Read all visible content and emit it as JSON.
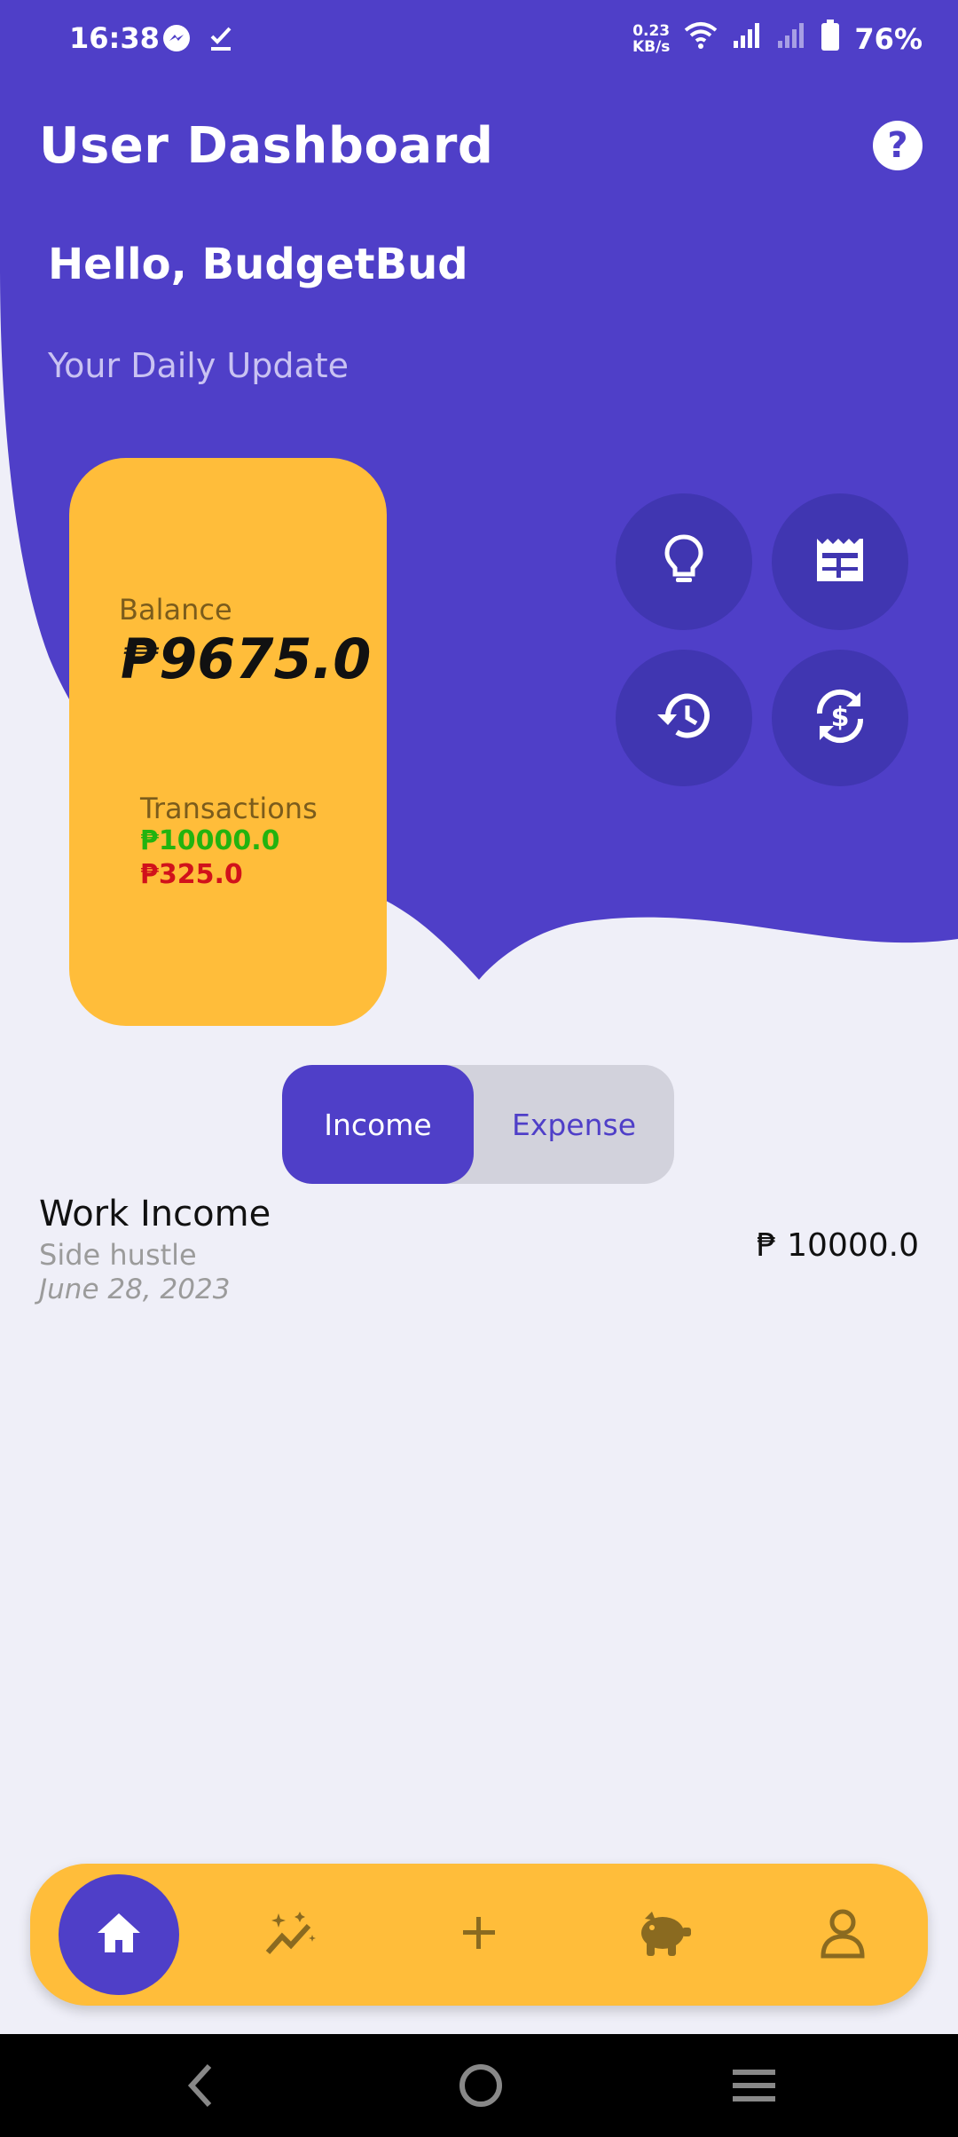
{
  "status_bar": {
    "time": "16:38",
    "net_speed_value": "0.23",
    "net_speed_unit": "KB/s",
    "battery": "76%",
    "icons": [
      "messenger-icon",
      "check-download-icon",
      "wifi-icon",
      "signal-icon",
      "signal-weak-icon",
      "battery-icon"
    ]
  },
  "header": {
    "title": "User Dashboard",
    "help_icon": "?"
  },
  "greeting": "Hello, BudgetBud",
  "subtitle": "Your Daily Update",
  "balance_card": {
    "balance_label": "Balance",
    "balance_value": "₱9675.0",
    "transactions_label": "Transactions",
    "income_total": "₱10000.0",
    "expense_total": "₱325.0"
  },
  "quick_actions": [
    "lightbulb-icon",
    "receipt-icon",
    "history-icon",
    "currency-exchange-icon"
  ],
  "toggle": {
    "income_label": "Income",
    "expense_label": "Expense",
    "selected": "Income"
  },
  "transactions": [
    {
      "title": "Work Income",
      "description": "Side hustle",
      "date": "June 28, 2023",
      "amount": "₱ 10000.0"
    }
  ],
  "bottom_nav": {
    "items": [
      "home-icon",
      "insights-icon",
      "add-icon",
      "savings-icon",
      "profile-icon"
    ],
    "active": "home-icon"
  },
  "colors": {
    "primary": "#4f3fc8",
    "primary_dark": "#4036b1",
    "accent": "#ffbd3a",
    "background": "#efeff8",
    "income": "#22b30f",
    "expense": "#d1121b"
  }
}
